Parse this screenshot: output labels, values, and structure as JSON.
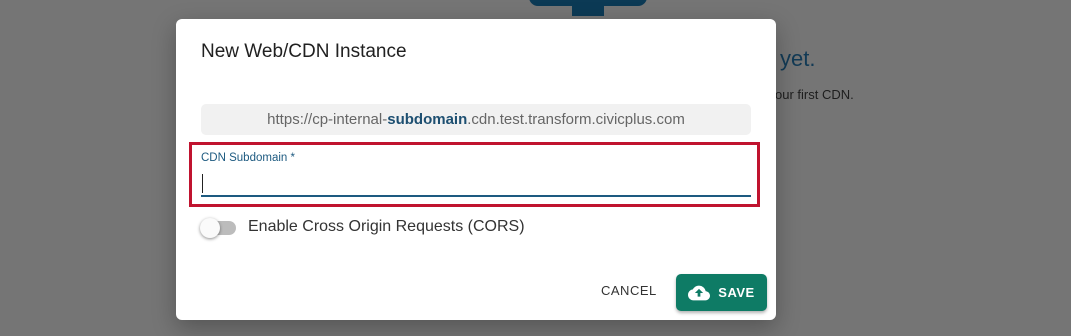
{
  "background": {
    "heading": "yet.",
    "subtext": "our first CDN."
  },
  "dialog": {
    "title": "New Web/CDN Instance",
    "url_preview": {
      "prefix": "https://cp-internal-",
      "highlight": "subdomain",
      "suffix": ".cdn.test.transform.civicplus.com"
    },
    "subdomain_field": {
      "label": "CDN Subdomain *",
      "value": ""
    },
    "cors_toggle": {
      "label": "Enable Cross Origin Requests (CORS)",
      "checked": false
    },
    "actions": {
      "cancel_label": "CANCEL",
      "save_label": "SAVE",
      "save_icon": "cloud-upload-icon"
    }
  },
  "colors": {
    "accent": "#1d5a80",
    "save_button": "#0e7b65",
    "highlight_border": "#c0132f",
    "overlay": "#757575"
  }
}
